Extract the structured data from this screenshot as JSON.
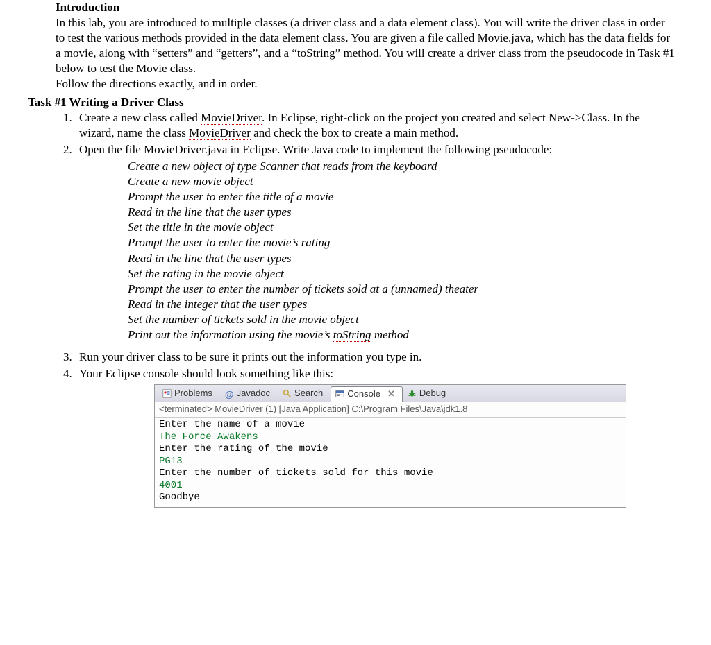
{
  "intro": {
    "heading": "Introduction",
    "body": "In this lab, you are introduced to multiple classes (a driver class and a data element class).  You will write the driver class in order to test the various methods provided in the data element class.  You are given a file called Movie.java, which has the data fields for a movie, along with “setters” and “getters”, and a “",
    "squiggle1": "toString",
    "body2": "” method.  You will create a driver class from the pseudocode in Task #1 below to test the Movie class.",
    "follow": "Follow the directions exactly, and in order."
  },
  "task": {
    "heading": "Task #1 Writing a Driver Class",
    "step1a": "Create a new class called ",
    "step1s1": "MovieDriver",
    "step1b": ".  In Eclipse, right-click on the project you created and select New->Class.  In the wizard, name the class ",
    "step1s2": "MovieDriver",
    "step1c": " and check the box to create a main method.",
    "step2": "Open the file MovieDriver.java in Eclipse.  Write Java code to implement the following pseudocode:",
    "pseudo": [
      "Create a new object of type Scanner that reads from the keyboard",
      "Create a new movie object",
      "Prompt the user to enter the title of a movie",
      "Read in the line that the user types",
      "Set the title in the movie object",
      "Prompt the user to enter the movie’s rating",
      "Read in the line that the user types",
      "Set the rating in the movie object",
      "Prompt the user to enter the number of tickets sold at a (unnamed) theater",
      "Read in the integer that the user types",
      "Set the number of tickets sold in the movie object"
    ],
    "pseudo_last_a": "Print out the information using the movie’s ",
    "pseudo_last_s": "toString",
    "pseudo_last_b": " method",
    "step3": "Run your driver class to be sure it prints out the information you type in.",
    "step4": "Your Eclipse console should look something like this:"
  },
  "eclipse": {
    "tabs": {
      "problems": "Problems",
      "javadoc": "Javadoc",
      "search": "Search",
      "console": "Console",
      "debug": "Debug"
    },
    "close_x": "✕",
    "status": "<terminated> MovieDriver (1) [Java Application] C:\\Program Files\\Java\\jdk1.8",
    "lines": {
      "l1": "Enter the name of a movie",
      "l2": "The Force Awakens",
      "l3": "Enter the rating of the movie",
      "l4": "PG13",
      "l5": "Enter the number of tickets sold for this movie",
      "l6": "4001",
      "l7": "Goodbye"
    }
  },
  "javadoc_at": "@"
}
